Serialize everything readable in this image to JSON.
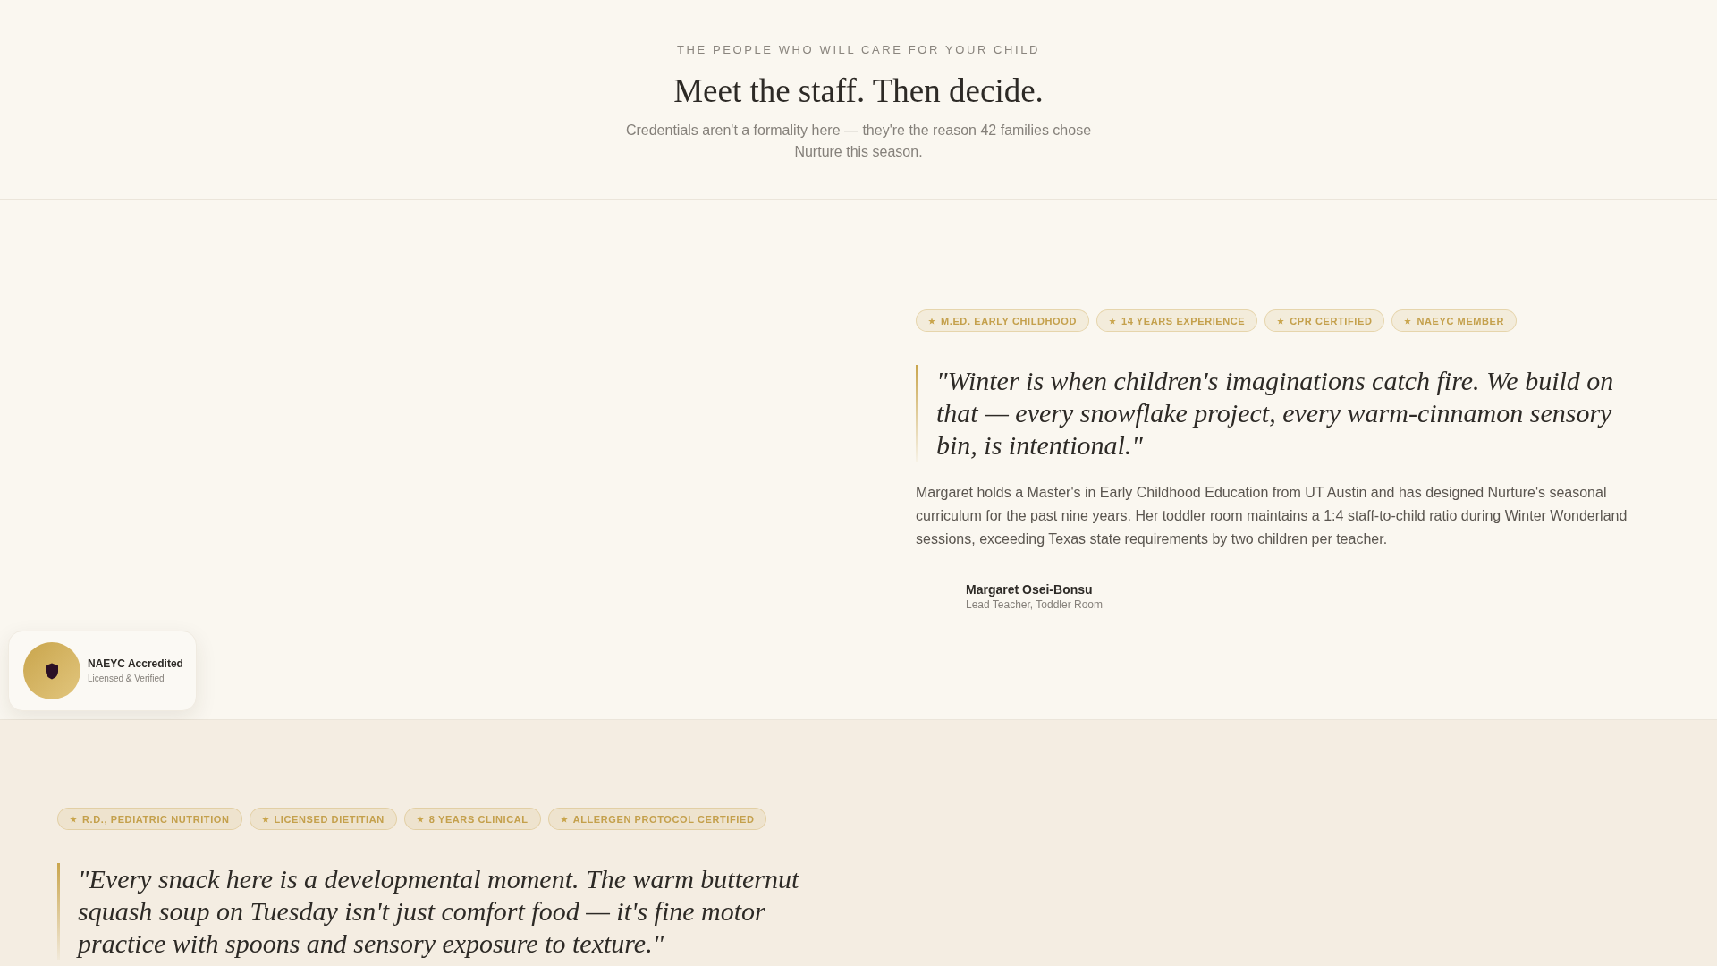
{
  "header": {
    "eyebrow": "THE PEOPLE WHO WILL CARE FOR YOUR CHILD",
    "title": "Meet the staff. Then decide.",
    "subtitle": "Credentials aren't a formality here — they're the reason 42 families chose Nurture this season."
  },
  "staff": [
    {
      "credentials": [
        "M.ED. EARLY CHILDHOOD",
        "14 YEARS EXPERIENCE",
        "CPR CERTIFIED",
        "NAEYC MEMBER"
      ],
      "quote": "\"Winter is when children's imaginations catch fire. We build on that — every snowflake project, every warm-cinnamon sensory bin, is intentional.\"",
      "bio": "Margaret holds a Master's in Early Childhood Education from UT Austin and has designed Nurture's seasonal curriculum for the past nine years. Her toddler room maintains a 1:4 staff-to-child ratio during Winter Wonderland sessions, exceeding Texas state requirements by two children per teacher.",
      "name": "Margaret Osei-Bonsu",
      "role": "Lead Teacher, Toddler Room",
      "badge": {
        "title": "NAEYC Accredited",
        "subtitle": "Licensed & Verified"
      }
    },
    {
      "credentials": [
        "R.D., PEDIATRIC NUTRITION",
        "LICENSED DIETITIAN",
        "8 YEARS CLINICAL",
        "ALLERGEN PROTOCOL CERTIFIED"
      ],
      "quote": "\"Every snack here is a developmental moment. The warm butternut squash soup on Tuesday isn't just comfort food — it's fine motor practice with spoons and sensory exposure to texture.\""
    }
  ]
}
